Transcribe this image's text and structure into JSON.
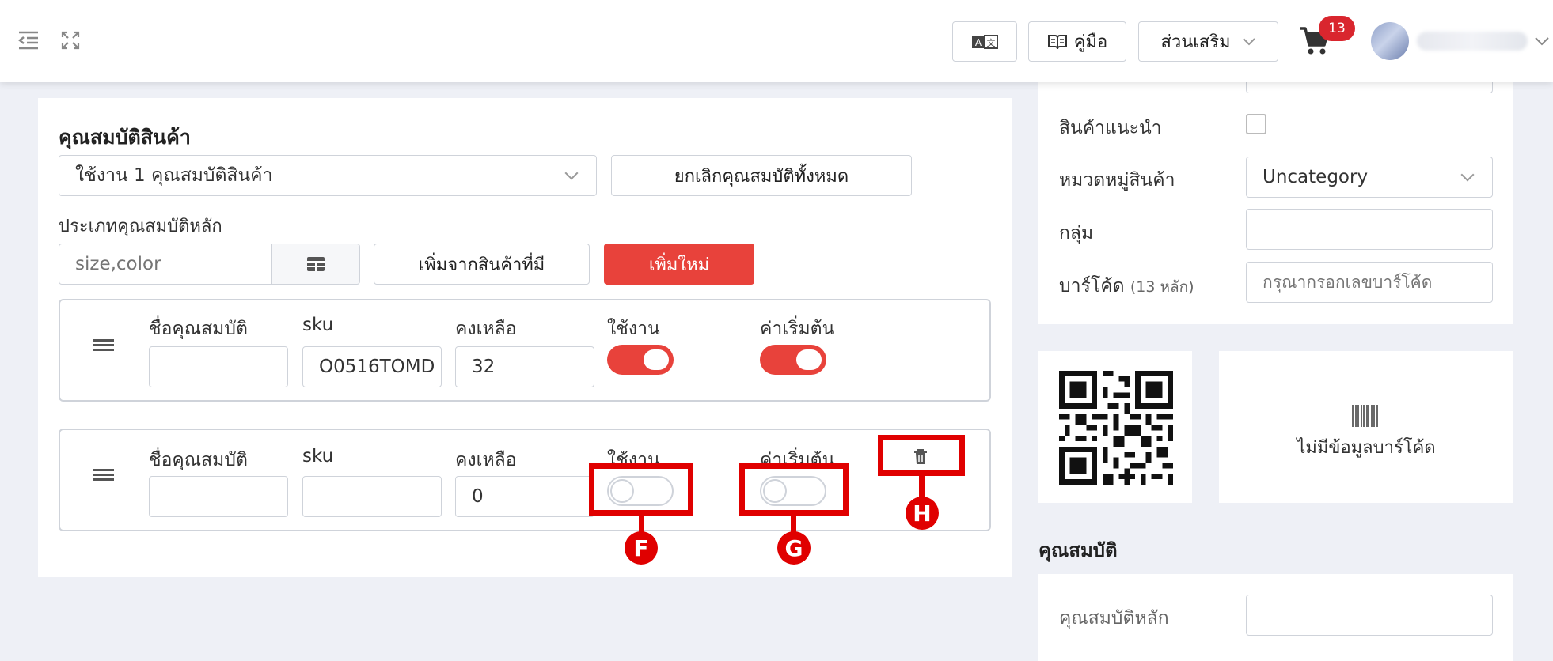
{
  "topbar": {
    "translate_icon": "translate-icon",
    "manual_label": "คู่มือ",
    "addons_label": "ส่วนเสริม",
    "cart_count": "13"
  },
  "variants": {
    "title": "คุณสมบัติสินค้า",
    "select_value": "ใช้งาน 1 คุณสมบัติสินค้า",
    "cancel_all_label": "ยกเลิกคุณสมบัติทั้งหมด",
    "main_type_label": "ประเภทคุณสมบัติหลัก",
    "main_type_placeholder": "size,color",
    "add_existing_label": "เพิ่มจากสินค้าที่มี",
    "add_new_label": "เพิ่มใหม่",
    "columns": {
      "name": "ชื่อคุณสมบัติ",
      "sku": "sku",
      "stock": "คงเหลือ",
      "active": "ใช้งาน",
      "default": "ค่าเริ่มต้น"
    },
    "rows": [
      {
        "name": "",
        "sku": "O0516TOMD",
        "stock": "32",
        "active": true,
        "default": true
      },
      {
        "name": "",
        "sku": "",
        "stock": "0",
        "active": false,
        "default": false
      }
    ]
  },
  "annotations": {
    "f": "F",
    "g": "G",
    "h": "H"
  },
  "side": {
    "recommended_label": "สินค้าแนะนำ",
    "category_label": "หมวดหมู่สินค้า",
    "category_value": "Uncategory",
    "group_label": "กลุ่ม",
    "barcode_label": "บาร์โค้ด",
    "barcode_hint": "(13 หลัก)",
    "barcode_placeholder": "กรุณากรอกเลขบาร์โค้ด",
    "no_barcode_text": "ไม่มีข้อมูลบาร์โค้ด",
    "props_title": "คุณสมบัติ",
    "main_prop_label": "คุณสมบัติหลัก"
  },
  "colors": {
    "accent": "#e8423b",
    "annotation": "#e00000",
    "badge": "#d9262e"
  }
}
